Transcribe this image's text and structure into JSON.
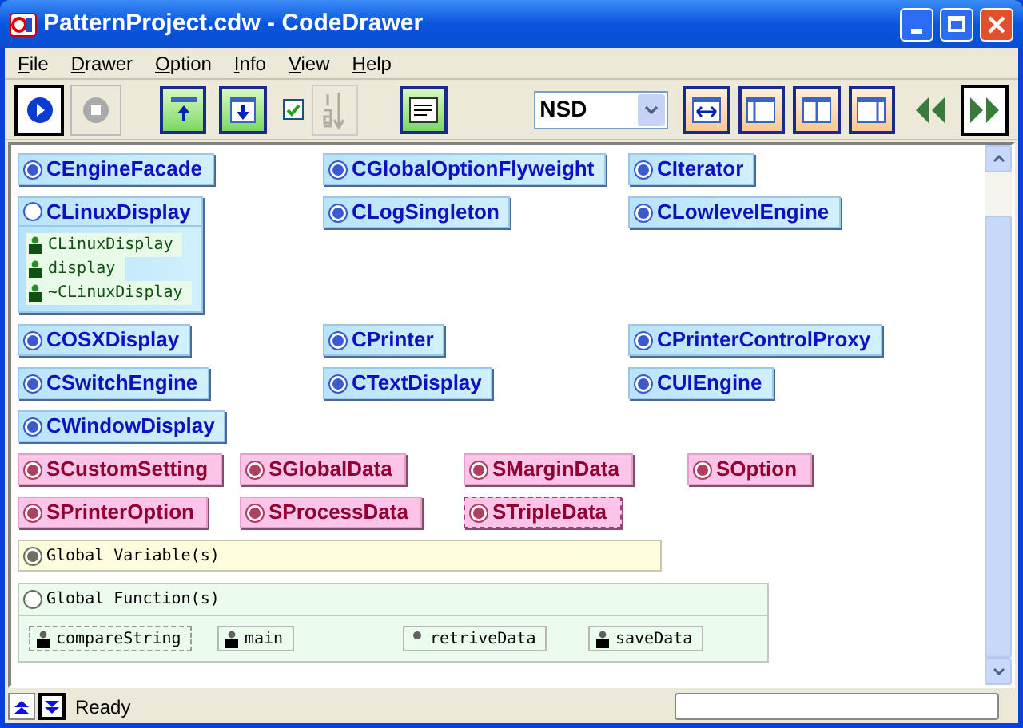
{
  "window": {
    "title": "PatternProject.cdw - CodeDrawer"
  },
  "menu": [
    "File",
    "Drawer",
    "Option",
    "Info",
    "View",
    "Help"
  ],
  "toolbar": {
    "show_numbers_checked": true,
    "view_mode": "NSD"
  },
  "classes": [
    {
      "name": "CEngineFacade",
      "expanded": false
    },
    {
      "name": "CGlobalOptionFlyweight",
      "expanded": false
    },
    {
      "name": "CIterator",
      "expanded": false
    },
    {
      "name": "CLinuxDisplay",
      "expanded": true,
      "members": [
        "CLinuxDisplay",
        "display",
        "~CLinuxDisplay"
      ]
    },
    {
      "name": "CLogSingleton",
      "expanded": false
    },
    {
      "name": "CLowlevelEngine",
      "expanded": false
    },
    {
      "name": "COSXDisplay",
      "expanded": false
    },
    {
      "name": "CPrinter",
      "expanded": false
    },
    {
      "name": "CPrinterControlProxy",
      "expanded": false
    },
    {
      "name": "CSwitchEngine",
      "expanded": false
    },
    {
      "name": "CTextDisplay",
      "expanded": false
    },
    {
      "name": "CUIEngine",
      "expanded": false
    },
    {
      "name": "CWindowDisplay",
      "expanded": false
    }
  ],
  "structs": [
    {
      "name": "SCustomSetting",
      "selected": false
    },
    {
      "name": "SGlobalData",
      "selected": false
    },
    {
      "name": "SMarginData",
      "selected": false
    },
    {
      "name": "SOption",
      "selected": false
    },
    {
      "name": "SPrinterOption",
      "selected": false
    },
    {
      "name": "SProcessData",
      "selected": false
    },
    {
      "name": "STripleData",
      "selected": true
    }
  ],
  "global_variables": {
    "label": "Global Variable(s)",
    "expanded": false
  },
  "global_functions": {
    "label": "Global Function(s)",
    "expanded": true,
    "items": [
      {
        "name": "compareString",
        "kind": "defined",
        "selected": true
      },
      {
        "name": "main",
        "kind": "defined",
        "selected": false
      },
      {
        "name": "retriveData",
        "kind": "declared",
        "selected": false
      },
      {
        "name": "saveData",
        "kind": "defined",
        "selected": false
      }
    ]
  },
  "status_bar": {
    "text": "Ready"
  }
}
